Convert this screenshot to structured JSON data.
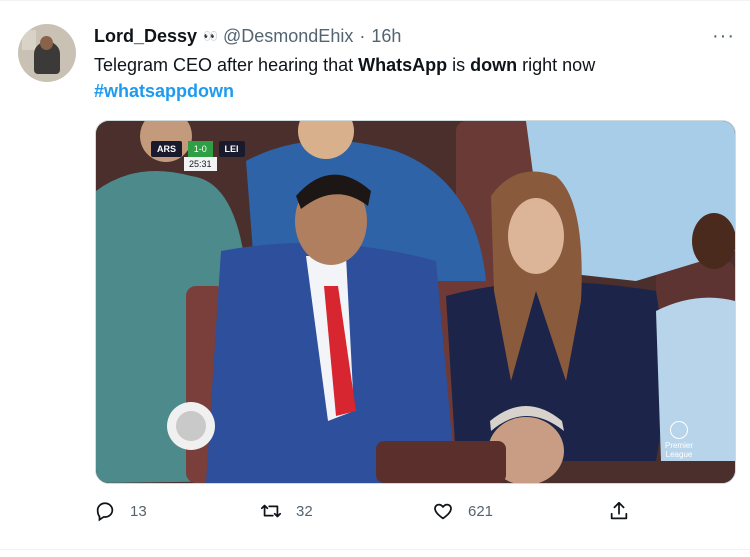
{
  "tweet": {
    "display_name": "Lord_Dessy",
    "name_emoji": "👀",
    "handle": "@DesmondEhix",
    "separator": "·",
    "time": "16h",
    "more_label": "···",
    "text_parts": {
      "p1": "Telegram CEO after hearing that ",
      "b1": "WhatsApp",
      "p2": " is ",
      "b2": "down",
      "p3": " right now"
    },
    "hashtag": "#whatsappdown"
  },
  "media": {
    "scorebug": {
      "home": "ARS",
      "score": "1-0",
      "clock": "25:31",
      "away": "LEI"
    },
    "watermark": {
      "line1": "Premier",
      "line2": "League"
    }
  },
  "actions": {
    "reply": {
      "icon": "reply-icon",
      "count": "13"
    },
    "retweet": {
      "icon": "retweet-icon",
      "count": "32"
    },
    "like": {
      "icon": "heart-icon",
      "count": "621"
    },
    "share": {
      "icon": "share-icon"
    }
  },
  "colors": {
    "link": "#1d9bf0",
    "muted": "#536471",
    "text": "#0f1419"
  }
}
